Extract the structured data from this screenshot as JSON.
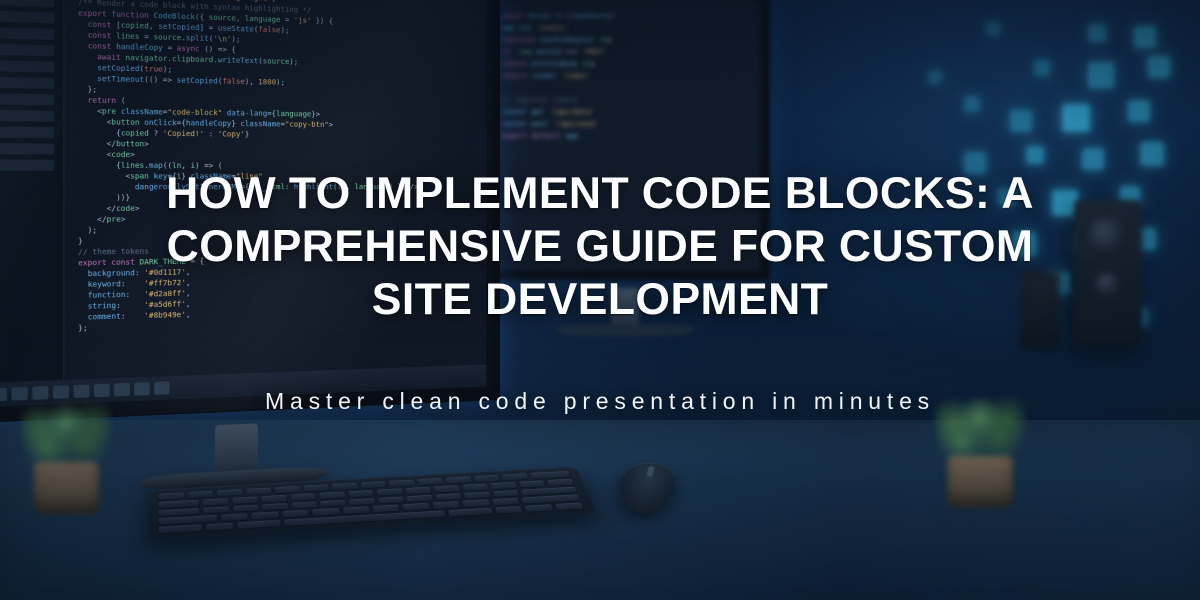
{
  "hero": {
    "title": "HOW TO IMPLEMENT CODE BLOCKS: A COMPREHENSIVE GUIDE FOR CUSTOM SITE DEVELOPMENT",
    "subtitle": "Master clean code presentation in minutes"
  }
}
